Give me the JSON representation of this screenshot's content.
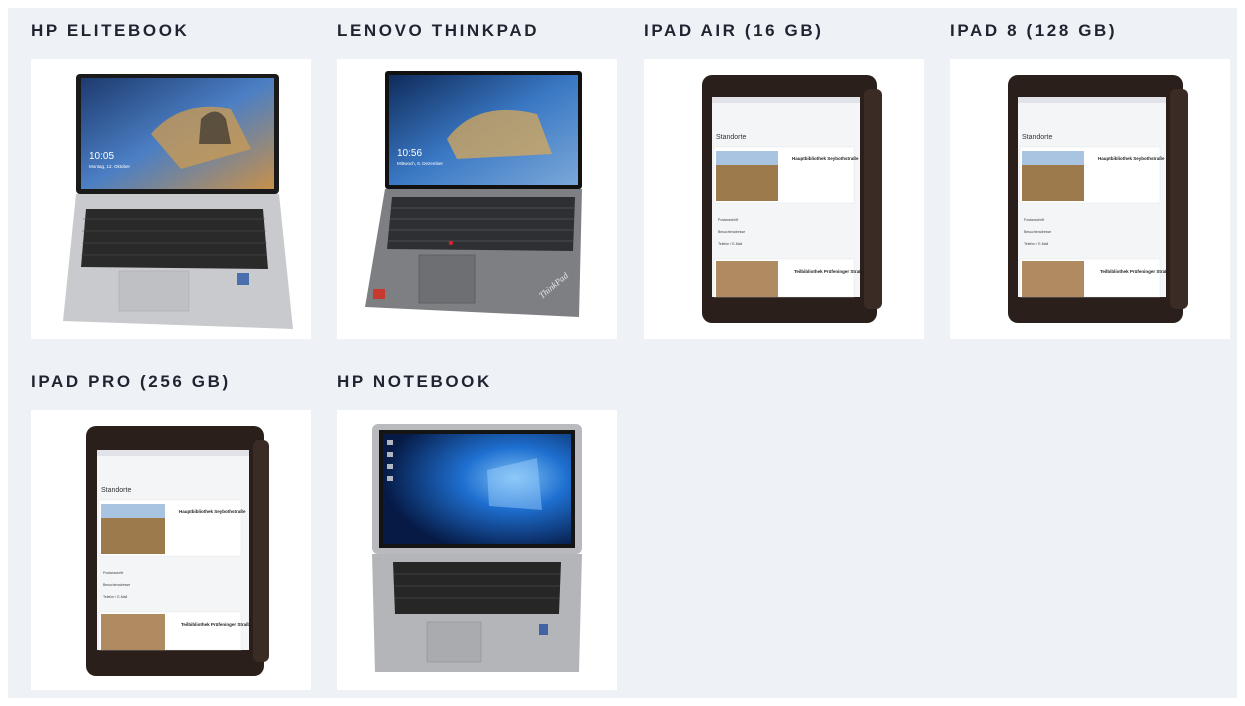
{
  "page": {
    "background": "#eef2f7",
    "title_color": "#1f2430"
  },
  "devices": [
    {
      "title": "HP ELITEBOOK",
      "icon": "laptop-photo",
      "laptop": {
        "os_time": "10:05",
        "os_date": "Montag, 12. Oktober"
      }
    },
    {
      "title": "LENOVO THINKPAD",
      "icon": "laptop-photo",
      "laptop": {
        "os_time": "10:56",
        "os_date": "Mittwoch, 8. Dezember",
        "brand_mark": "ThinkPad"
      }
    },
    {
      "title": "IPAD AIR (16 GB)",
      "icon": "tablet-photo",
      "tablet": {
        "screen_heading": "Standorte",
        "card1_title": "Hauptbibliothek Seybothstraße",
        "rows": [
          "Postanschrift",
          "Besucheradresse",
          "Telefon / E-Mail"
        ],
        "card2_title": "Teilbibliothek Prüfeninger Straße"
      }
    },
    {
      "title": "IPAD 8 (128 GB)",
      "icon": "tablet-photo",
      "tablet": {
        "screen_heading": "Standorte",
        "card1_title": "Hauptbibliothek Seybothstraße",
        "rows": [
          "Postanschrift",
          "Besucheradresse",
          "Telefon / E-Mail"
        ],
        "card2_title": "Teilbibliothek Prüfeninger Straße"
      }
    },
    {
      "title": "IPAD PRO (256 GB)",
      "icon": "tablet-photo",
      "tablet": {
        "screen_heading": "Standorte",
        "card1_title": "Hauptbibliothek Seybothstraße",
        "rows": [
          "Postanschrift",
          "Besucheradresse",
          "Telefon / E-Mail"
        ],
        "card2_title": "Teilbibliothek Prüfeninger Straße"
      }
    },
    {
      "title": "HP NOTEBOOK",
      "icon": "laptop-photo"
    }
  ]
}
